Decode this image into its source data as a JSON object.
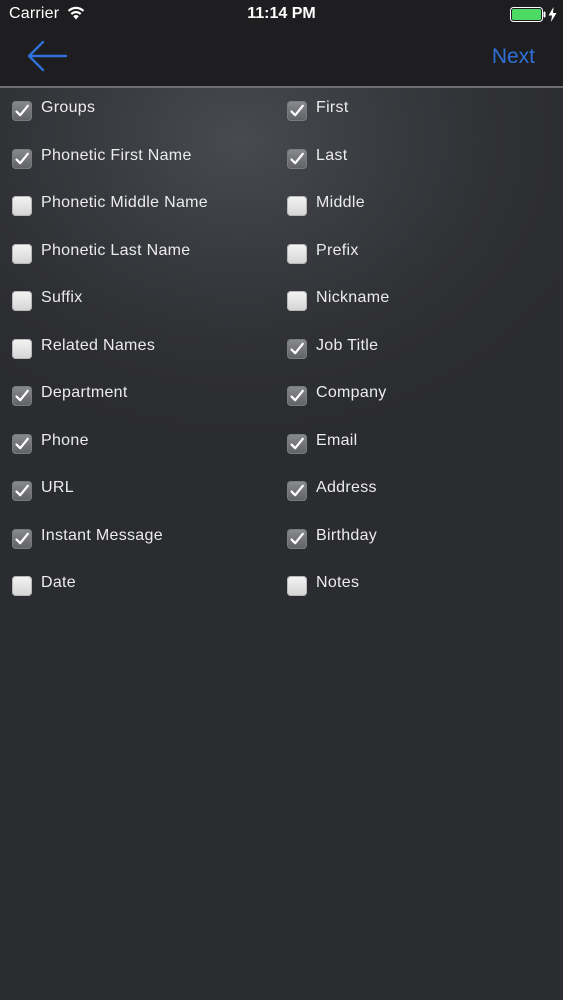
{
  "status_bar": {
    "carrier": "Carrier",
    "time": "11:14 PM",
    "battery_color": "#4cd964"
  },
  "nav": {
    "back_icon": "left-arrow-icon",
    "next_label": "Next",
    "accent_color": "#2e70d8"
  },
  "left_options": [
    {
      "label": "Groups",
      "checked": true
    },
    {
      "label": "Phonetic First Name",
      "checked": true
    },
    {
      "label": "Phonetic Middle Name",
      "checked": false
    },
    {
      "label": "Phonetic Last Name",
      "checked": false
    },
    {
      "label": "Suffix",
      "checked": false
    },
    {
      "label": "Related Names",
      "checked": false
    },
    {
      "label": "Department",
      "checked": true
    },
    {
      "label": "Phone",
      "checked": true
    },
    {
      "label": "URL",
      "checked": true
    },
    {
      "label": "Instant Message",
      "checked": true
    },
    {
      "label": "Date",
      "checked": false
    }
  ],
  "right_options": [
    {
      "label": "First",
      "checked": true
    },
    {
      "label": "Last",
      "checked": true
    },
    {
      "label": "Middle",
      "checked": false
    },
    {
      "label": "Prefix",
      "checked": false
    },
    {
      "label": "Nickname",
      "checked": false
    },
    {
      "label": "Job Title",
      "checked": true
    },
    {
      "label": "Company",
      "checked": true
    },
    {
      "label": "Email",
      "checked": true
    },
    {
      "label": "Address",
      "checked": true
    },
    {
      "label": "Birthday",
      "checked": true
    },
    {
      "label": "Notes",
      "checked": false
    }
  ]
}
